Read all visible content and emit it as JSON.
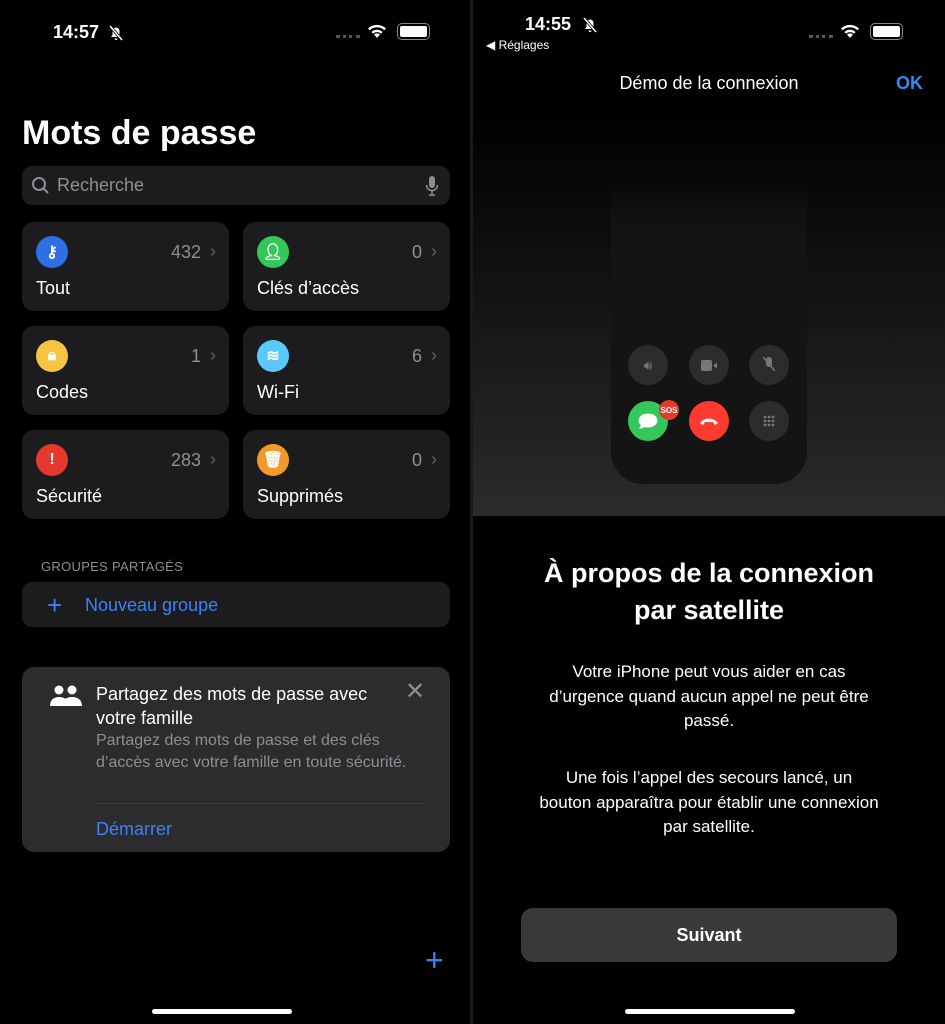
{
  "left": {
    "status": {
      "time": "14:57"
    },
    "title": "Mots de passe",
    "search": {
      "placeholder": "Recherche"
    },
    "tiles": [
      {
        "label": "Tout",
        "count": "432",
        "icon": "key-icon",
        "color": "#2f6fe4"
      },
      {
        "label": "Clés d’accès",
        "count": "0",
        "icon": "person-key-icon",
        "color": "#34c759"
      },
      {
        "label": "Codes",
        "count": "1",
        "icon": "lock-clock-icon",
        "color": "#f5c542"
      },
      {
        "label": "Wi-Fi",
        "count": "6",
        "icon": "wifi-icon",
        "color": "#5ac8fa"
      },
      {
        "label": "Sécurité",
        "count": "283",
        "icon": "exclamation-icon",
        "color": "#e5392f"
      },
      {
        "label": "Supprimés",
        "count": "0",
        "icon": "trash-icon",
        "color": "#f09a2a"
      }
    ],
    "shared_groups_header": "GROUPES PARTAGÉS",
    "new_group": "Nouveau groupe",
    "share_card": {
      "title": "Partagez des mots de passe avec votre famille",
      "body": "Partagez des mots de passe et des clés d’accès avec votre famille en toute sécurité.",
      "action": "Démarrer"
    }
  },
  "right": {
    "status": {
      "time": "14:55",
      "back": "Réglages"
    },
    "nav_title": "Démo de la connexion",
    "ok": "OK",
    "sos_badge": "SOS",
    "heading_line1": "À propos de la connexion",
    "heading_line2": "par satellite",
    "para1": [
      "Votre iPhone peut vous aider en cas",
      "d’urgence quand aucun appel ne peut être",
      "passé."
    ],
    "para2": [
      "Une fois l’appel des secours lancé, un",
      "bouton apparaîtra pour établir une connexion",
      "par satellite."
    ],
    "button": "Suivant"
  },
  "accent": "#3b82f6"
}
